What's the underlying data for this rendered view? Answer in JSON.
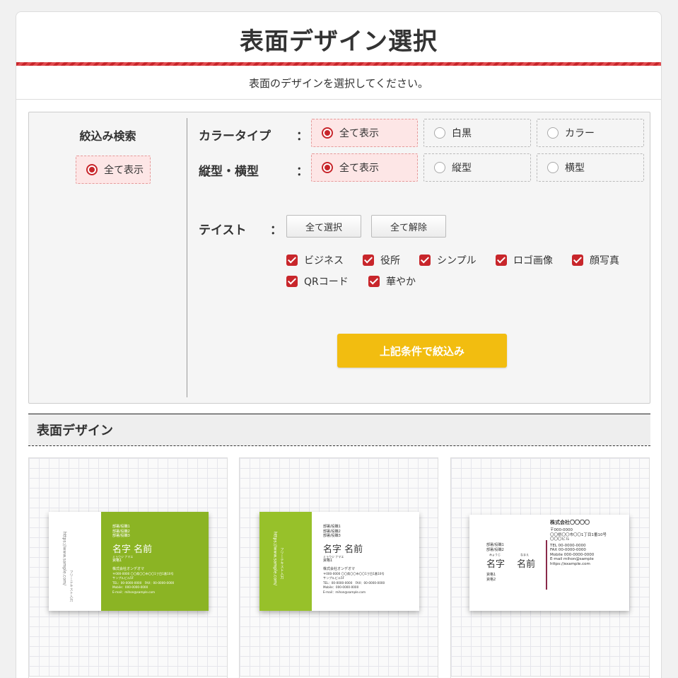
{
  "page": {
    "title": "表面デザイン選択",
    "subtitle": "表面のデザインを選択してください。"
  },
  "filter": {
    "heading": "絞込み検索",
    "left_option": "全て表示",
    "color_type": {
      "label": "カラータイプ",
      "colon": "：",
      "options": [
        "全て表示",
        "白黒",
        "カラー"
      ],
      "selected": "全て表示"
    },
    "orientation": {
      "label": "縦型・横型",
      "colon": "：",
      "options": [
        "全て表示",
        "縦型",
        "横型"
      ],
      "selected": "全て表示"
    },
    "taste": {
      "label": "テイスト",
      "colon": "：",
      "select_all": "全て選択",
      "clear_all": "全て解除",
      "items": [
        "ビジネス",
        "役所",
        "シンプル",
        "ロゴ画像",
        "顔写真",
        "QRコード",
        "華やか"
      ]
    },
    "submit": "上記条件で絞込み"
  },
  "section": {
    "heading": "表面デザイン"
  },
  "designs": [
    {
      "side_text": "https://www.sample.com/",
      "side_text2": "フリーテキスト入力",
      "titles": [
        "部署/役職1",
        "部署/役職2",
        "部署/役職3"
      ],
      "name": "名字 名前",
      "furigana": "ミョウジ ナマエ",
      "qual": "資格1",
      "company": "株式会社オンデオマ",
      "lines": [
        "〒000-0000 〇〇県〇〇市〇〇1丁目1番10号",
        "サンプルビル5F",
        "TEL：00-0000-0000　FAX：00-0000-0000",
        "Mobile：000-0000-0000",
        "E-mail：mihon@sample.com"
      ]
    },
    {
      "side_text": "https://www.sample.com/",
      "side_text2": "フリーテキスト入力",
      "titles": [
        "部署/役職1",
        "部署/役職2",
        "部署/役職3"
      ],
      "name": "名字 名前",
      "furigana": "ミョウジ ナマエ",
      "qual": "資格1",
      "company": "株式会社オンデオマ",
      "lines": [
        "〒000-0000 〇〇県〇〇市〇〇1丁目1番10号",
        "サンプルビル5F",
        "TEL：00-0000-0000　FAX：00-0000-0000",
        "Mobile：000-0000-0000",
        "E-mail：mihon@sample.com"
      ]
    },
    {
      "titles": [
        "部署/役職1",
        "部署/役職2"
      ],
      "name_sei": "名字",
      "name_mei": "名前",
      "furi_sei": "みょうじ",
      "furi_mei": "なまえ",
      "quals": [
        "資格1",
        "資格2"
      ],
      "company": "株式会社〇〇〇〇",
      "lines": [
        "〒000-0000",
        "〇〇県〇〇市〇〇1丁目1番10号",
        "〇〇〇ビル",
        "TEL 00-0000-0000",
        "FAX 00-0000-0000",
        "Mobile 000-0000-0000",
        "E-mail mihon@sample",
        "https://example.com"
      ]
    }
  ],
  "colors": {
    "accent_red": "#c8262b",
    "submit_yellow": "#f2bd10",
    "card_green": "#8bb424"
  }
}
